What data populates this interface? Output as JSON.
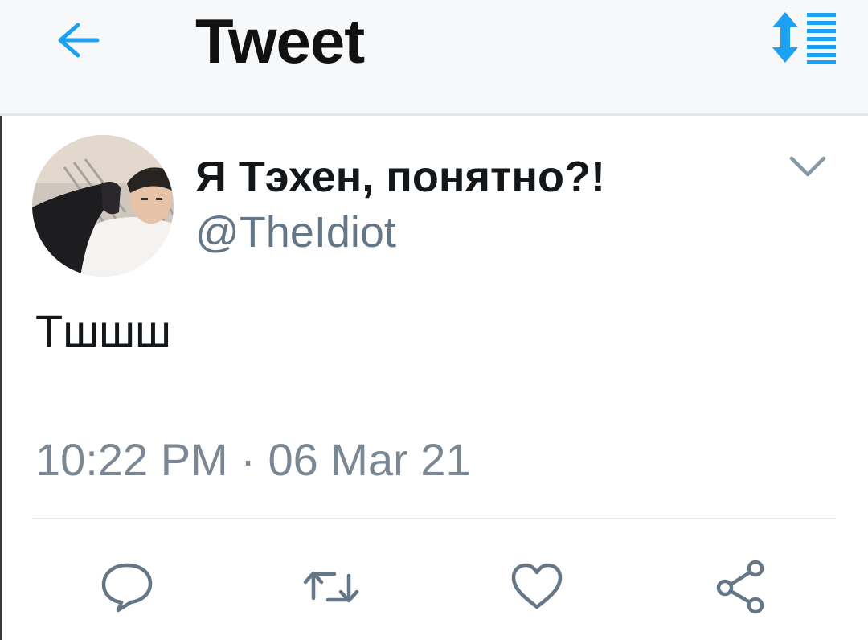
{
  "header": {
    "title": "Tweet",
    "back_icon": "arrow-left-icon",
    "sort_icon": "sort-list-icon"
  },
  "tweet": {
    "display_name": "Я Тэхен, понятно?!",
    "handle": "@TheIdiot",
    "text": "Тшшш",
    "timestamp": "10:22 PM · 06 Mar 21",
    "menu_icon": "chevron-down-icon"
  },
  "actions": [
    {
      "name": "reply",
      "icon": "reply-icon"
    },
    {
      "name": "retweet",
      "icon": "retweet-icon"
    },
    {
      "name": "like",
      "icon": "heart-icon"
    },
    {
      "name": "share",
      "icon": "share-icon"
    }
  ],
  "colors": {
    "accent": "#1da1f2",
    "text_primary": "#14171a",
    "text_secondary": "#657786",
    "icon_gray": "#657786"
  }
}
